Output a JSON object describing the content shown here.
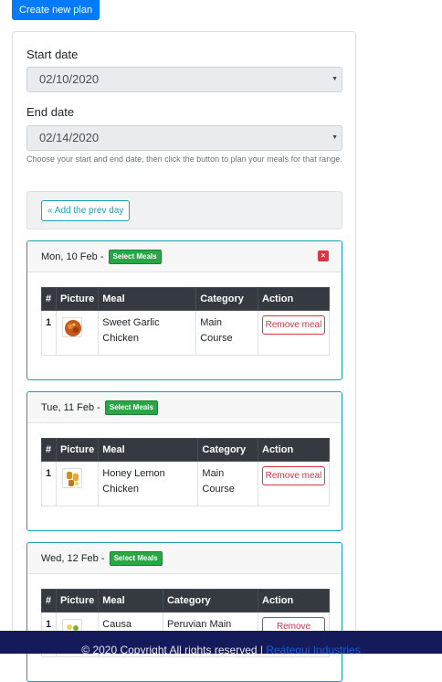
{
  "toolbar": {
    "create_plan_label": "Create new plan"
  },
  "form": {
    "start_label": "Start date",
    "start_value": "02/10/2020",
    "end_label": "End date",
    "end_value": "02/14/2020",
    "help_text": "Choose your start and end date, then click the button to plan your meals for that range.",
    "prev_day_label": "« Add the prev day"
  },
  "table_headers": [
    "#",
    "Picture",
    "Meal",
    "Category",
    "Action"
  ],
  "select_meals_label": "Select Meals",
  "close_glyph": "×",
  "days": [
    {
      "title": "Mon, 10 Feb -",
      "meals": [
        {
          "num": "1",
          "meal": "Sweet Garlic Chicken",
          "category": "Main Course",
          "action": "Remove meal"
        }
      ]
    },
    {
      "title": "Tue, 11 Feb -",
      "meals": [
        {
          "num": "1",
          "meal": "Honey Lemon Chicken",
          "category": "Main Course",
          "action": "Remove meal"
        }
      ]
    },
    {
      "title": "Wed, 12 Feb -",
      "meals": [
        {
          "num": "1",
          "meal": "Causa",
          "category": "Peruvian Main",
          "action": "Remove"
        }
      ]
    }
  ],
  "footer": {
    "text": "© 2020 Copyright All rights reserved | ",
    "link": "Reátegui Industries"
  },
  "colors": {
    "primary": "#007bff",
    "info": "#17a2b8",
    "success": "#28a745",
    "danger": "#dc3545",
    "footer_bg": "#141a5a"
  }
}
